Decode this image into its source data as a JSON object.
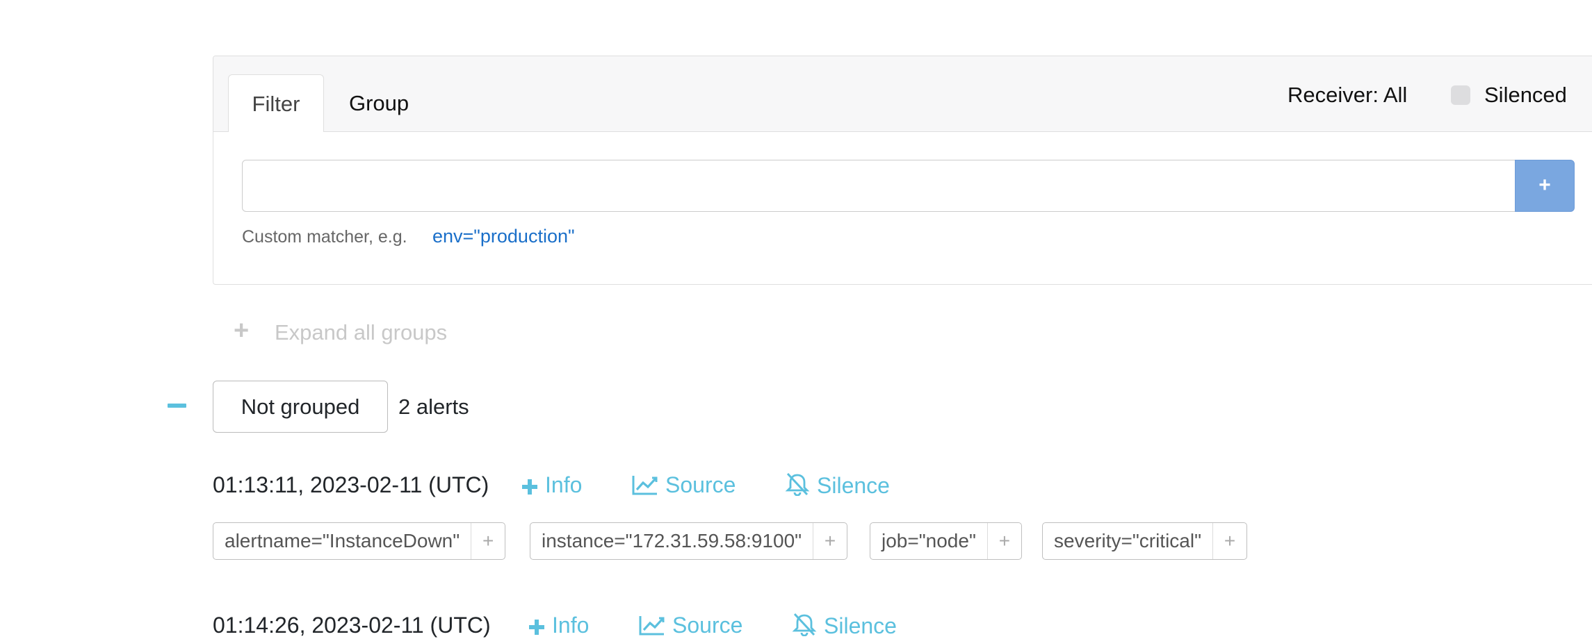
{
  "filter_panel": {
    "tabs": [
      "Filter",
      "Group"
    ],
    "receiver_label": "Receiver: All",
    "silenced_label": "Silenced",
    "input_value": "",
    "add_button_label": "+",
    "hint_text": "Custom matcher, e.g.",
    "hint_example": "env=\"production\""
  },
  "expand_all": {
    "icon": "plus-icon",
    "label": "Expand all groups"
  },
  "group": {
    "collapse_icon": "minus-icon",
    "name": "Not grouped",
    "count": "2 alerts"
  },
  "alerts": [
    {
      "time": "01:13:11, 2023-02-11 (UTC)",
      "info_label": "Info",
      "source_label": "Source",
      "silence_label": "Silence",
      "labels": [
        "alertname=\"InstanceDown\"",
        "instance=\"172.31.59.58:9100\"",
        "job=\"node\"",
        "severity=\"critical\""
      ]
    },
    {
      "time": "01:14:26, 2023-02-11 (UTC)",
      "info_label": "Info",
      "source_label": "Source",
      "silence_label": "Silence"
    }
  ],
  "colors": {
    "accent": "#5bc0de",
    "add_button": "#7aa7e0",
    "link": "#1a6fc9"
  }
}
